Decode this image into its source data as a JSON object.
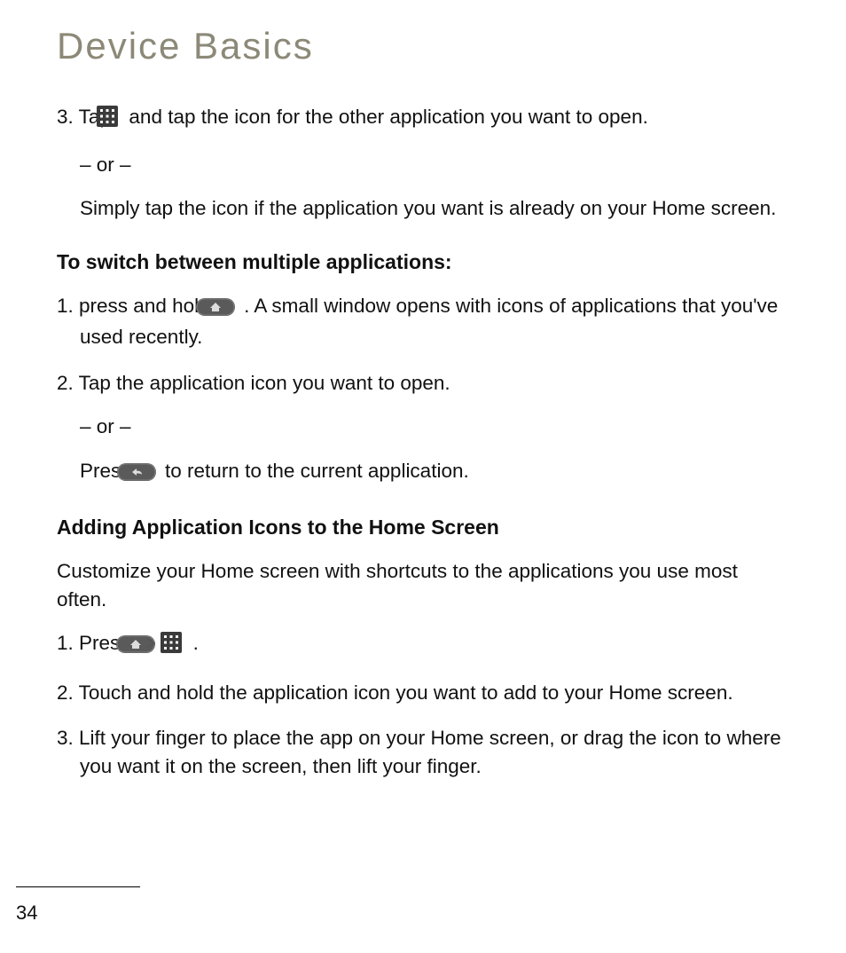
{
  "title": "Device Basics",
  "step3": {
    "num": "3.",
    "a": "Tap ",
    "b": " and tap the icon for the other application you want to open.",
    "or": "– or –",
    "c": "Simply tap the icon if the application you want is already on your Home screen."
  },
  "switch_heading": "To switch between multiple applications:",
  "sw1": {
    "num": "1.",
    "a": "press and hold ",
    "b": ". A small window opens with icons of applications that you've used recently."
  },
  "sw2": {
    "num": "2.",
    "text": "Tap the application icon you want to open.",
    "or": "– or –",
    "press_a": "Press ",
    "press_b": " to return to the current application."
  },
  "adding_heading": "Adding Application Icons to the Home Screen",
  "adding_intro": "Customize your Home screen with shortcuts to the applications you use most often.",
  "add1": {
    "num": "1.",
    "a": "Press ",
    "gt": ">",
    "end": "."
  },
  "add2": {
    "num": "2.",
    "text": "Touch and hold the application icon you want to add to your Home screen."
  },
  "add3": {
    "num": "3.",
    "text": "Lift your finger to place the app on your Home screen, or drag the icon to where you want it on the screen, then lift your finger."
  },
  "page_number": "34"
}
